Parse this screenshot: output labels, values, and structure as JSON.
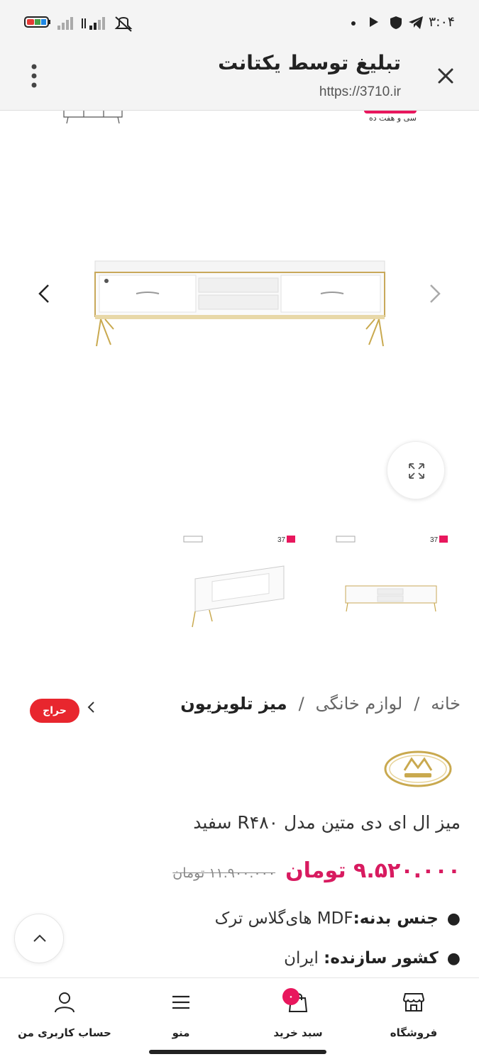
{
  "status_bar": {
    "time": "۳:۰۴"
  },
  "browser": {
    "title": "تبلیغ توسط یکتانت",
    "url": "https://3710.ir"
  },
  "gallery": {
    "brand_mark": "سی و هفت ده"
  },
  "breadcrumb": {
    "items": [
      "خانه",
      "لوازم خانگی",
      "میز تلویزیون"
    ],
    "separator": "/"
  },
  "sale_badge": "حراج",
  "product": {
    "title": "میز ال ای دی متین مدل R۴۸۰ سفید",
    "old_price": "۱۱.۹۰۰.۰۰۰ تومان",
    "new_price": "۹.۵۲۰.۰۰۰ تومان",
    "specs": [
      {
        "label": "جنس بدنه:",
        "value": "MDF های‌گلاس ترک"
      },
      {
        "label": "کشور سازنده:",
        "value": " ایران"
      }
    ]
  },
  "bottom_nav": {
    "store": "فروشگاه",
    "cart": "سبد خرید",
    "cart_count": "۰",
    "menu": "منو",
    "account": "حساب کاربری من"
  },
  "colors": {
    "accent": "#d81b60",
    "badge": "#e8262e"
  }
}
